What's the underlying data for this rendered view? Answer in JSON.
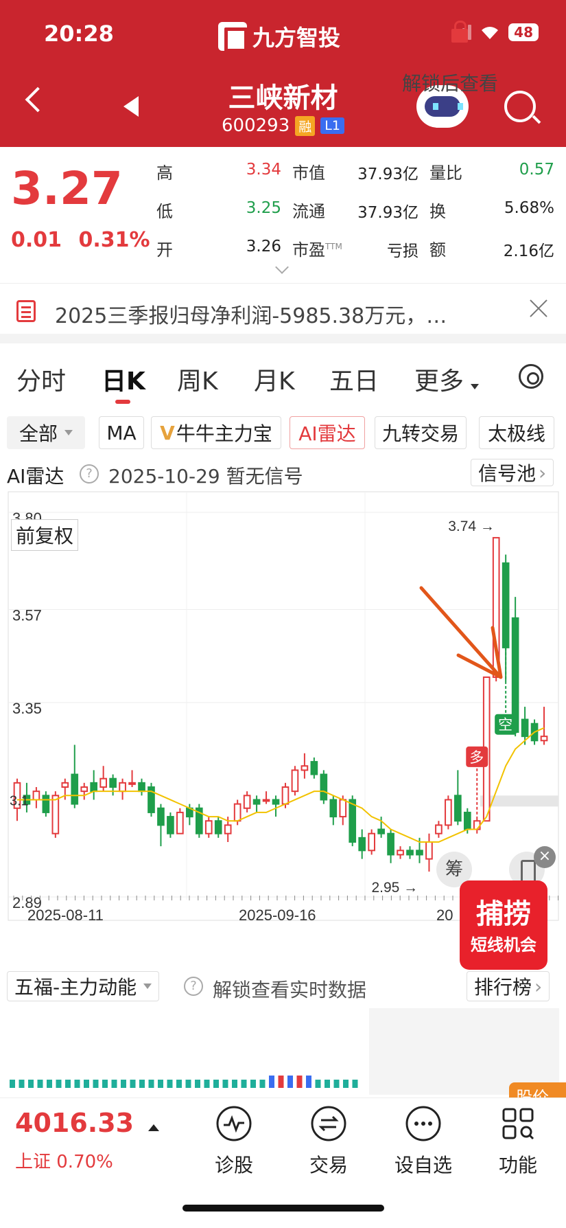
{
  "status": {
    "time": "20:28",
    "app_name": "九方智投",
    "battery": "48"
  },
  "header": {
    "stock_name": "三峡新材",
    "stock_code": "600293",
    "badge_rong": "融",
    "badge_level": "L1"
  },
  "quote": {
    "price": "3.27",
    "change": "0.01",
    "change_pct": "0.31%",
    "stats": [
      {
        "label": "高",
        "value": "3.34",
        "color": "red"
      },
      {
        "label": "市值",
        "value": "37.93亿",
        "color": "dark"
      },
      {
        "label": "量比",
        "value": "0.57",
        "color": "green"
      },
      {
        "label": "低",
        "value": "3.25",
        "color": "green"
      },
      {
        "label": "流通",
        "value": "37.93亿",
        "color": "dark"
      },
      {
        "label": "换",
        "value": "5.68%",
        "color": "dark"
      },
      {
        "label": "开",
        "value": "3.26",
        "color": "dark"
      },
      {
        "label": "市盈",
        "label_sup": "TTM",
        "value": "亏损",
        "color": "dark"
      },
      {
        "label": "额",
        "value": "2.16亿",
        "color": "dark"
      }
    ]
  },
  "notice": {
    "text": "2025三季报归母净利润-5985.38万元，…"
  },
  "tabs": [
    "分时",
    "日K",
    "周K",
    "月K",
    "五日",
    "更多"
  ],
  "active_tab": "日K",
  "indicators": {
    "all": "全部",
    "ma": "MA",
    "niuniu": "牛牛主力宝",
    "ai_radar": "AI雷达",
    "jiuzhuan": "九转交易",
    "taiji": "太极线"
  },
  "radar": {
    "title": "AI雷达",
    "date_status": "2025-10-29  暂无信号",
    "signal_pool": "信号池"
  },
  "chart": {
    "fuquan": "前复权",
    "y_labels": [
      "3.80",
      "3.57",
      "3.35",
      "2.89"
    ],
    "x_labels": [
      "2025-08-11",
      "2025-09-16",
      "20"
    ],
    "high_marker": "3.74 →",
    "low_marker": "2.95 →",
    "left_label": "3.1",
    "signal_buy": "多",
    "signal_sell": "空"
  },
  "chart_data": {
    "type": "candlestick",
    "ylim": [
      2.89,
      3.8
    ],
    "ma_color": "#f2c200",
    "up_color": "#e33a3d",
    "down_color": "#1f9e4b",
    "candles": [
      {
        "o": 3.1,
        "c": 3.16,
        "h": 3.17,
        "l": 3.07
      },
      {
        "o": 3.13,
        "c": 3.11,
        "h": 3.16,
        "l": 3.09
      },
      {
        "o": 3.12,
        "c": 3.14,
        "h": 3.15,
        "l": 3.1
      },
      {
        "o": 3.13,
        "c": 3.09,
        "h": 3.14,
        "l": 3.08
      },
      {
        "o": 3.04,
        "c": 3.13,
        "h": 3.14,
        "l": 3.03
      },
      {
        "o": 3.15,
        "c": 3.16,
        "h": 3.17,
        "l": 3.12
      },
      {
        "o": 3.18,
        "c": 3.11,
        "h": 3.25,
        "l": 3.1
      },
      {
        "o": 3.14,
        "c": 3.15,
        "h": 3.16,
        "l": 3.12
      },
      {
        "o": 3.16,
        "c": 3.14,
        "h": 3.19,
        "l": 3.12
      },
      {
        "o": 3.15,
        "c": 3.17,
        "h": 3.2,
        "l": 3.14
      },
      {
        "o": 3.17,
        "c": 3.15,
        "h": 3.18,
        "l": 3.13
      },
      {
        "o": 3.14,
        "c": 3.16,
        "h": 3.17,
        "l": 3.12
      },
      {
        "o": 3.16,
        "c": 3.16,
        "h": 3.19,
        "l": 3.15
      },
      {
        "o": 3.16,
        "c": 3.14,
        "h": 3.17,
        "l": 3.13
      },
      {
        "o": 3.15,
        "c": 3.09,
        "h": 3.16,
        "l": 3.08
      },
      {
        "o": 3.1,
        "c": 3.06,
        "h": 3.11,
        "l": 3.01
      },
      {
        "o": 3.08,
        "c": 3.04,
        "h": 3.09,
        "l": 3.03
      },
      {
        "o": 3.04,
        "c": 3.09,
        "h": 3.1,
        "l": 3.04
      },
      {
        "o": 3.1,
        "c": 3.08,
        "h": 3.11,
        "l": 3.06
      },
      {
        "o": 3.1,
        "c": 3.04,
        "h": 3.11,
        "l": 3.03
      },
      {
        "o": 3.04,
        "c": 3.07,
        "h": 3.08,
        "l": 3.03
      },
      {
        "o": 3.07,
        "c": 3.04,
        "h": 3.08,
        "l": 3.03
      },
      {
        "o": 3.04,
        "c": 3.06,
        "h": 3.08,
        "l": 3.02
      },
      {
        "o": 3.07,
        "c": 3.11,
        "h": 3.12,
        "l": 3.06
      },
      {
        "o": 3.1,
        "c": 3.13,
        "h": 3.14,
        "l": 3.09
      },
      {
        "o": 3.12,
        "c": 3.11,
        "h": 3.13,
        "l": 3.09
      },
      {
        "o": 3.12,
        "c": 3.12,
        "h": 3.14,
        "l": 3.11
      },
      {
        "o": 3.12,
        "c": 3.11,
        "h": 3.13,
        "l": 3.08
      },
      {
        "o": 3.11,
        "c": 3.15,
        "h": 3.16,
        "l": 3.1
      },
      {
        "o": 3.14,
        "c": 3.19,
        "h": 3.2,
        "l": 3.13
      },
      {
        "o": 3.19,
        "c": 3.2,
        "h": 3.23,
        "l": 3.17
      },
      {
        "o": 3.21,
        "c": 3.18,
        "h": 3.22,
        "l": 3.17
      },
      {
        "o": 3.18,
        "c": 3.12,
        "h": 3.19,
        "l": 3.11
      },
      {
        "o": 3.12,
        "c": 3.08,
        "h": 3.13,
        "l": 3.06
      },
      {
        "o": 3.08,
        "c": 3.12,
        "h": 3.13,
        "l": 3.06
      },
      {
        "o": 3.12,
        "c": 3.02,
        "h": 3.13,
        "l": 3.01
      },
      {
        "o": 3.03,
        "c": 3.0,
        "h": 3.05,
        "l": 2.98
      },
      {
        "o": 3.0,
        "c": 3.04,
        "h": 3.05,
        "l": 2.99
      },
      {
        "o": 3.05,
        "c": 3.04,
        "h": 3.08,
        "l": 3.03
      },
      {
        "o": 3.04,
        "c": 2.99,
        "h": 3.05,
        "l": 2.97
      },
      {
        "o": 2.99,
        "c": 3.0,
        "h": 3.01,
        "l": 2.98
      },
      {
        "o": 3.0,
        "c": 2.99,
        "h": 3.01,
        "l": 2.98
      },
      {
        "o": 3.0,
        "c": 2.99,
        "h": 3.03,
        "l": 2.97
      },
      {
        "o": 2.98,
        "c": 3.02,
        "h": 3.04,
        "l": 2.95
      },
      {
        "o": 3.04,
        "c": 3.06,
        "h": 3.07,
        "l": 3.03
      },
      {
        "o": 3.06,
        "c": 3.12,
        "h": 3.13,
        "l": 3.05
      },
      {
        "o": 3.13,
        "c": 3.07,
        "h": 3.19,
        "l": 3.06
      },
      {
        "o": 3.09,
        "c": 3.05,
        "h": 3.1,
        "l": 3.04
      },
      {
        "o": 3.05,
        "c": 3.07,
        "h": 3.08,
        "l": 3.04
      },
      {
        "o": 3.07,
        "c": 3.41,
        "h": 3.41,
        "l": 3.07
      },
      {
        "o": 3.41,
        "c": 3.74,
        "h": 3.74,
        "l": 3.4
      },
      {
        "o": 3.68,
        "c": 3.48,
        "h": 3.7,
        "l": 3.4
      },
      {
        "o": 3.55,
        "c": 3.28,
        "h": 3.6,
        "l": 3.27
      },
      {
        "o": 3.31,
        "c": 3.27,
        "h": 3.34,
        "l": 3.25
      },
      {
        "o": 3.3,
        "c": 3.26,
        "h": 3.31,
        "l": 3.25
      },
      {
        "o": 3.26,
        "c": 3.27,
        "h": 3.34,
        "l": 3.25
      }
    ],
    "ma": [
      3.12,
      3.12,
      3.12,
      3.12,
      3.12,
      3.13,
      3.13,
      3.13,
      3.14,
      3.14,
      3.14,
      3.14,
      3.14,
      3.14,
      3.14,
      3.13,
      3.12,
      3.11,
      3.1,
      3.09,
      3.08,
      3.08,
      3.07,
      3.07,
      3.08,
      3.09,
      3.09,
      3.1,
      3.11,
      3.12,
      3.13,
      3.14,
      3.14,
      3.13,
      3.12,
      3.11,
      3.1,
      3.08,
      3.07,
      3.05,
      3.04,
      3.03,
      3.02,
      3.02,
      3.02,
      3.03,
      3.04,
      3.05,
      3.05,
      3.08,
      3.14,
      3.2,
      3.24,
      3.26,
      3.28,
      3.29
    ]
  },
  "wufu": {
    "select": "五福-主力动能",
    "unlock_text": "解锁查看实时数据",
    "rank": "排行榜",
    "unlock_after": "解锁后查看",
    "price_remind": "股价提"
  },
  "promo": {
    "main": "捕捞",
    "sub": "短线机会",
    "chou": "筹"
  },
  "bottom": {
    "index_value": "4016.33",
    "index_name": "上证 0.70%",
    "nav": [
      "诊股",
      "交易",
      "设自选",
      "功能"
    ]
  }
}
